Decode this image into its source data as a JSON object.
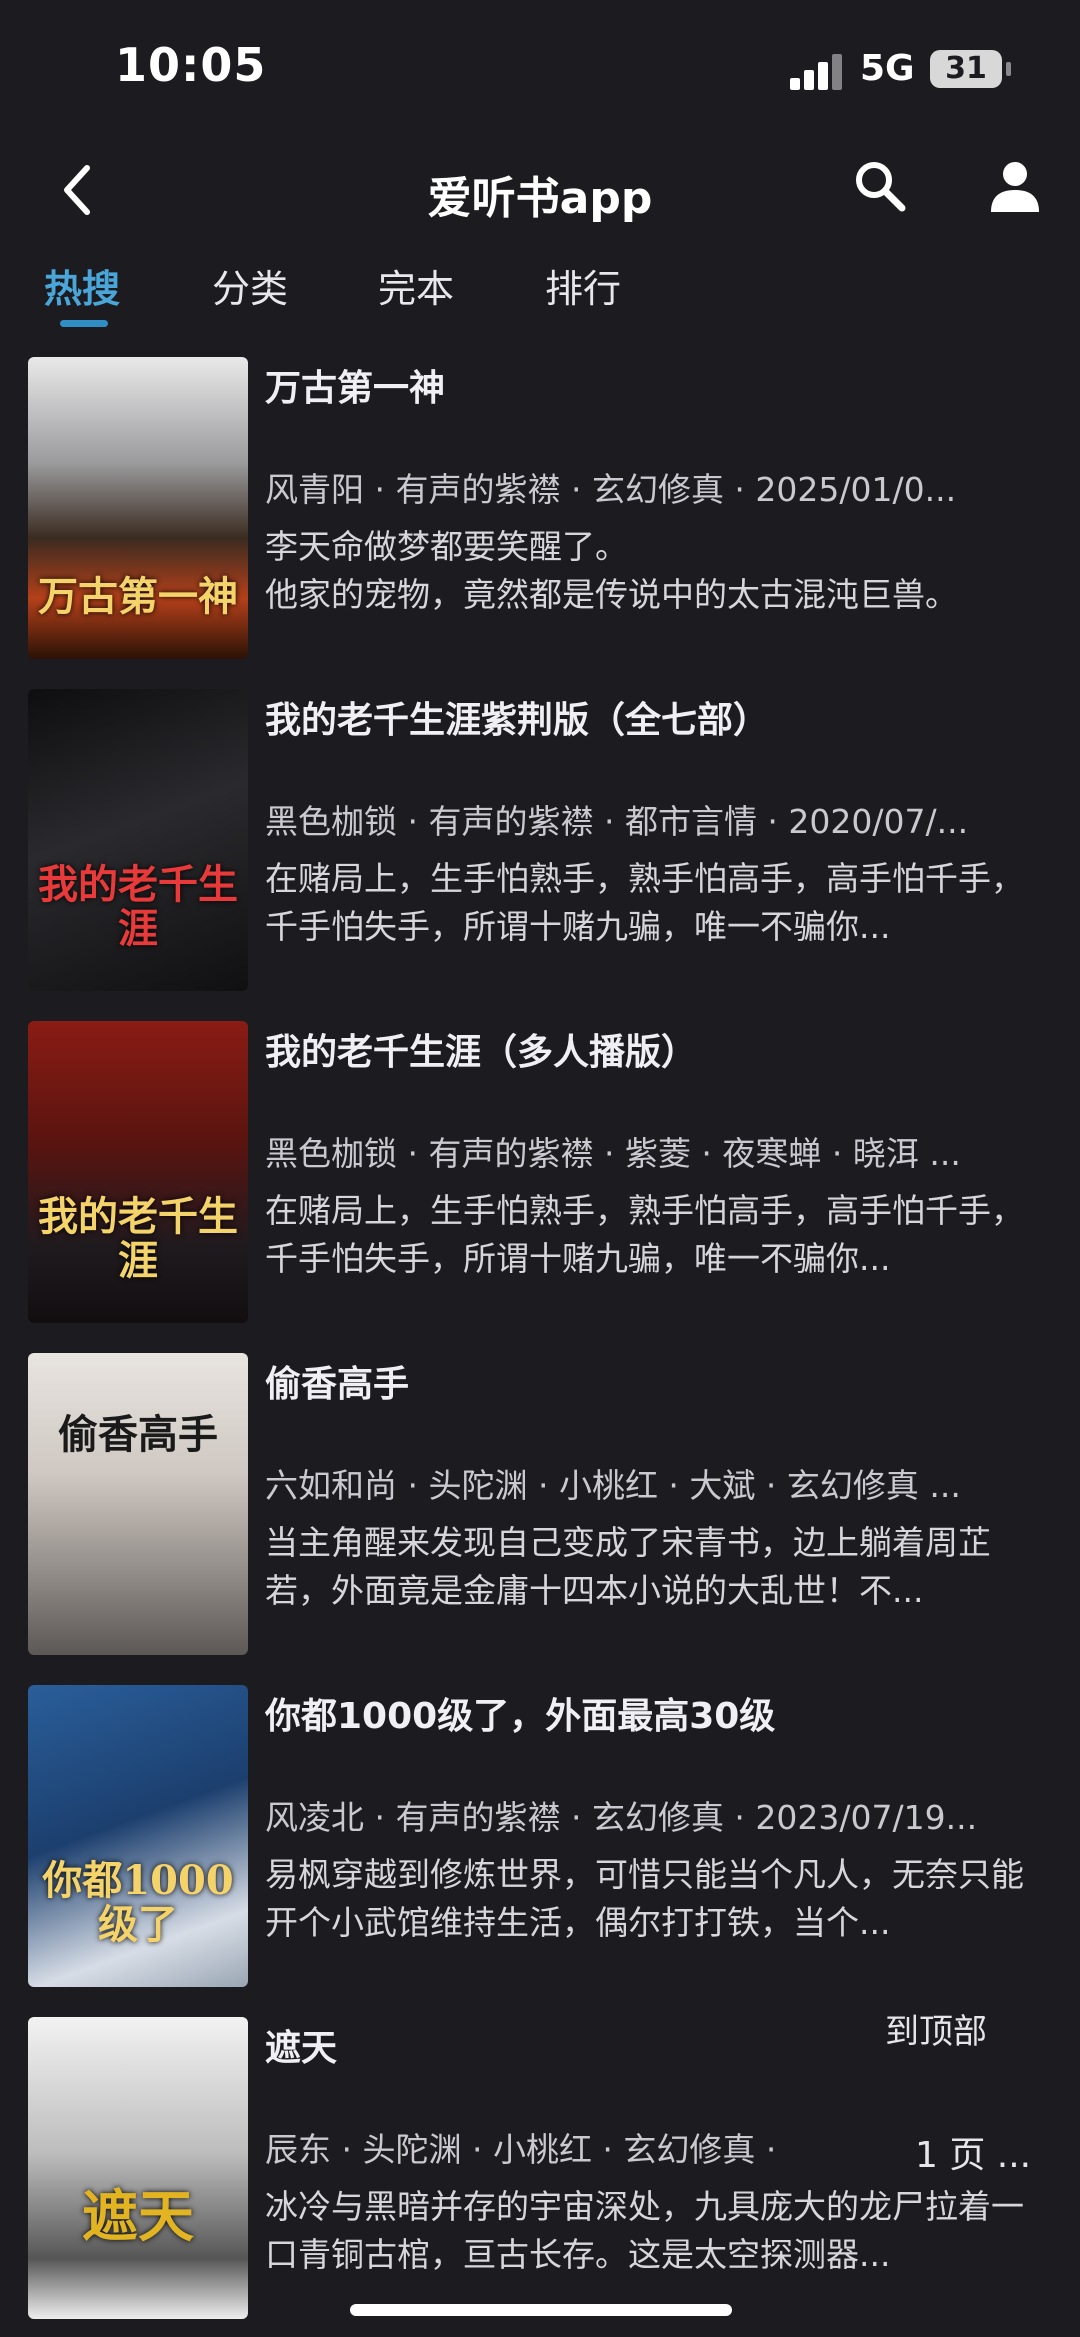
{
  "status": {
    "time": "10:05",
    "network": "5G",
    "battery": "31"
  },
  "header": {
    "title": "爱听书app",
    "back_icon": "chevron-left-icon",
    "search_icon": "search-icon",
    "user_icon": "user-icon"
  },
  "tabs": [
    {
      "label": "热搜",
      "active": true
    },
    {
      "label": "分类",
      "active": false
    },
    {
      "label": "完本",
      "active": false
    },
    {
      "label": "排行",
      "active": false
    }
  ],
  "accent_color": "#2f8fc4",
  "books": [
    {
      "title": "万古第一神",
      "meta": "风青阳 · 有声的紫襟 · 玄幻修真 · 2025/01/0...",
      "desc": "李天命做梦都要笑醒了。\n他家的宠物，竟然都是传说中的太古混沌巨兽。",
      "cover_text": "万古第一神"
    },
    {
      "title": "我的老千生涯紫荆版（全七部）",
      "meta": "黑色枷锁 · 有声的紫襟 · 都市言情 · 2020/07/...",
      "desc": "在赌局上，生手怕熟手，熟手怕高手，高手怕千手，千手怕失手，所谓十赌九骗，唯一不骗你...",
      "cover_text": "我的老千生涯"
    },
    {
      "title": "我的老千生涯（多人播版）",
      "meta": "黑色枷锁 · 有声的紫襟 · 紫菱 · 夜寒蝉 · 晓洱 ...",
      "desc": "在赌局上，生手怕熟手，熟手怕高手，高手怕千手，千手怕失手，所谓十赌九骗，唯一不骗你...",
      "cover_text": "我的老千生涯"
    },
    {
      "title": "偷香高手",
      "meta": "六如和尚 · 头陀渊 · 小桃红 · 大斌 · 玄幻修真 ...",
      "desc": "当主角醒来发现自己变成了宋青书，边上躺着周芷若，外面竟是金庸十四本小说的大乱世！不...",
      "cover_text": "偷香高手"
    },
    {
      "title": "你都1000级了，外面最高30级",
      "meta": "风凌北 · 有声的紫襟 · 玄幻修真 · 2023/07/19...",
      "desc": "易枫穿越到修炼世界，可惜只能当个凡人，无奈只能开个小武馆维持生活，偶尔打打铁，当个...",
      "cover_text": "你都1000级了"
    },
    {
      "title": "遮天",
      "meta": "辰东 · 头陀渊 · 小桃红 · 玄幻修真 · ",
      "desc": "冰冷与黑暗并存的宇宙深处，九具庞大的龙尸拉着一口青铜古棺，亘古长存。这是太空探测器...",
      "cover_text": "遮天"
    }
  ],
  "controls": {
    "to_top": "到顶部",
    "page": "1 页 ..."
  }
}
